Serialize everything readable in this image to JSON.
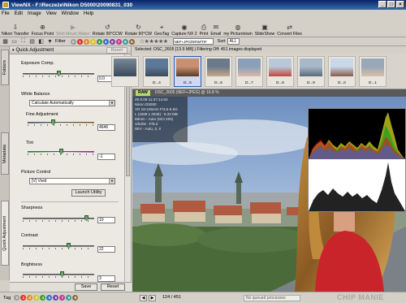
{
  "window": {
    "title": "ViewNX - F:\\Reczeże\\Nikon D5000\\20090831_030"
  },
  "menu": [
    "File",
    "Edit",
    "Image",
    "View",
    "Window",
    "Help"
  ],
  "toolbar": {
    "items": [
      {
        "label": "Nikon Transfer",
        "icon": "transfer-icon",
        "disabled": false
      },
      {
        "label": "Focus Point",
        "icon": "focus-point-icon",
        "disabled": false
      },
      {
        "label": "Web Movie Maker",
        "icon": "movie-icon",
        "disabled": true
      },
      {
        "label": "Rotate 90°CCW",
        "icon": "rotate-ccw-icon",
        "disabled": false
      },
      {
        "label": "Rotate 90°CW",
        "icon": "rotate-cw-icon",
        "disabled": false
      },
      {
        "label": "GeoTag",
        "icon": "geotag-icon",
        "disabled": false
      },
      {
        "label": "Capture NX 2",
        "icon": "capture-nx-icon",
        "disabled": false
      },
      {
        "label": "Print",
        "icon": "print-icon",
        "disabled": false
      },
      {
        "label": "Email",
        "icon": "email-icon",
        "disabled": false
      },
      {
        "label": "my Picturetown",
        "icon": "picturetown-icon",
        "disabled": false
      },
      {
        "label": "SlideShow",
        "icon": "slideshow-icon",
        "disabled": false
      },
      {
        "label": "Convert Files",
        "icon": "convert-icon",
        "disabled": false
      }
    ]
  },
  "toolbar2": {
    "filter_label": "Filter",
    "label_numbers": [
      "0",
      "1",
      "2",
      "3",
      "4",
      "5",
      "6",
      "7",
      "8",
      "9"
    ],
    "label_colors": [
      "#9a9a9a",
      "#d9342b",
      "#e38a1e",
      "#d9c223",
      "#3a9a3a",
      "#2f6fc2",
      "#7a3fb0",
      "#c03a8a",
      "#3a9a9a",
      "#8a6a3a"
    ],
    "rating_stars": "☆★★★★★",
    "type_filter": "NEF+JPG/NRW/TIF",
    "sort_label": "Sort",
    "sort_value": "ALL"
  },
  "left_tabs": [
    "Folders",
    "Metadata",
    "Quick Adjustment"
  ],
  "panel": {
    "title": "Quick Adjustment",
    "reset_label": "Reset",
    "exposure": {
      "label": "Exposure Comp.",
      "value": "0.0",
      "unit": "EV",
      "position": 0.5
    },
    "white_balance": {
      "label": "White Balance",
      "value": "Calculate Automatically"
    },
    "fine_adjustment": {
      "label": "Fine Adjustment",
      "value": "4646",
      "position": 0.38
    },
    "tint": {
      "label": "Tint",
      "value": "-1",
      "position": 0.5
    },
    "picture_control": {
      "label": "Picture Control",
      "value": "[V] Vivid",
      "launch_label": "Launch Utility"
    },
    "sharpness": {
      "label": "Sharpness",
      "value": "10",
      "position": 0.92
    },
    "contrast": {
      "label": "Contrast",
      "value": "22",
      "position": 0.65
    },
    "brightness": {
      "label": "Brightness",
      "value": "3",
      "position": 0.55
    },
    "save_label": "Save",
    "footer_reset_label": "Reset"
  },
  "selection_info": "Selected: DSC_2605 [13.9 MB] | Filtering Off: 451 images displayed",
  "filmstrip": [
    {
      "caption": "D...4",
      "selected": false,
      "colors": [
        "#5e7898",
        "#3a4a5a"
      ]
    },
    {
      "caption": "D...5",
      "selected": true,
      "colors": [
        "#c89070",
        "#5a3a2a"
      ]
    },
    {
      "caption": "D...6",
      "selected": false,
      "colors": [
        "#6a7a8a",
        "#c8a888"
      ]
    },
    {
      "caption": "D...7",
      "selected": false,
      "colors": [
        "#8aa0b8",
        "#d8b8a8"
      ]
    },
    {
      "caption": "D...8",
      "selected": false,
      "colors": [
        "#b8c8d8",
        "#c0483a"
      ]
    },
    {
      "caption": "D...9",
      "selected": false,
      "colors": [
        "#a8b8c8",
        "#5a6a7a"
      ]
    },
    {
      "caption": "D...0",
      "selected": false,
      "colors": [
        "#c8d8e8",
        "#8a5a4a"
      ]
    },
    {
      "caption": "D...1",
      "selected": false,
      "colors": [
        "#98a8b8",
        "#d8c0a8"
      ]
    }
  ],
  "viewer": {
    "raw_tag": "RAW",
    "filename": "DSC_2605 (NEF+JPEG) @ 16.8 %",
    "exif": [
      "29.8.09 11:37:14.50",
      "Nikon D5000",
      "VR 18-105mm F/3.5-5.6G",
      "L (4288 x 2848) : 9.33 MB",
      "58mm - Auto (ISO 200)",
      "1/640s - F/6.3",
      "0EV - Auto, 0, 0"
    ]
  },
  "statusbar": {
    "tag_label": "Tag",
    "count": "124 / 451",
    "processing": "No queued processes",
    "watermark": "CHIP MANIE"
  },
  "colors": {
    "titlebar": "#0a246a",
    "raw_tag": "#b7d67a",
    "selection": "#2a5db0"
  }
}
